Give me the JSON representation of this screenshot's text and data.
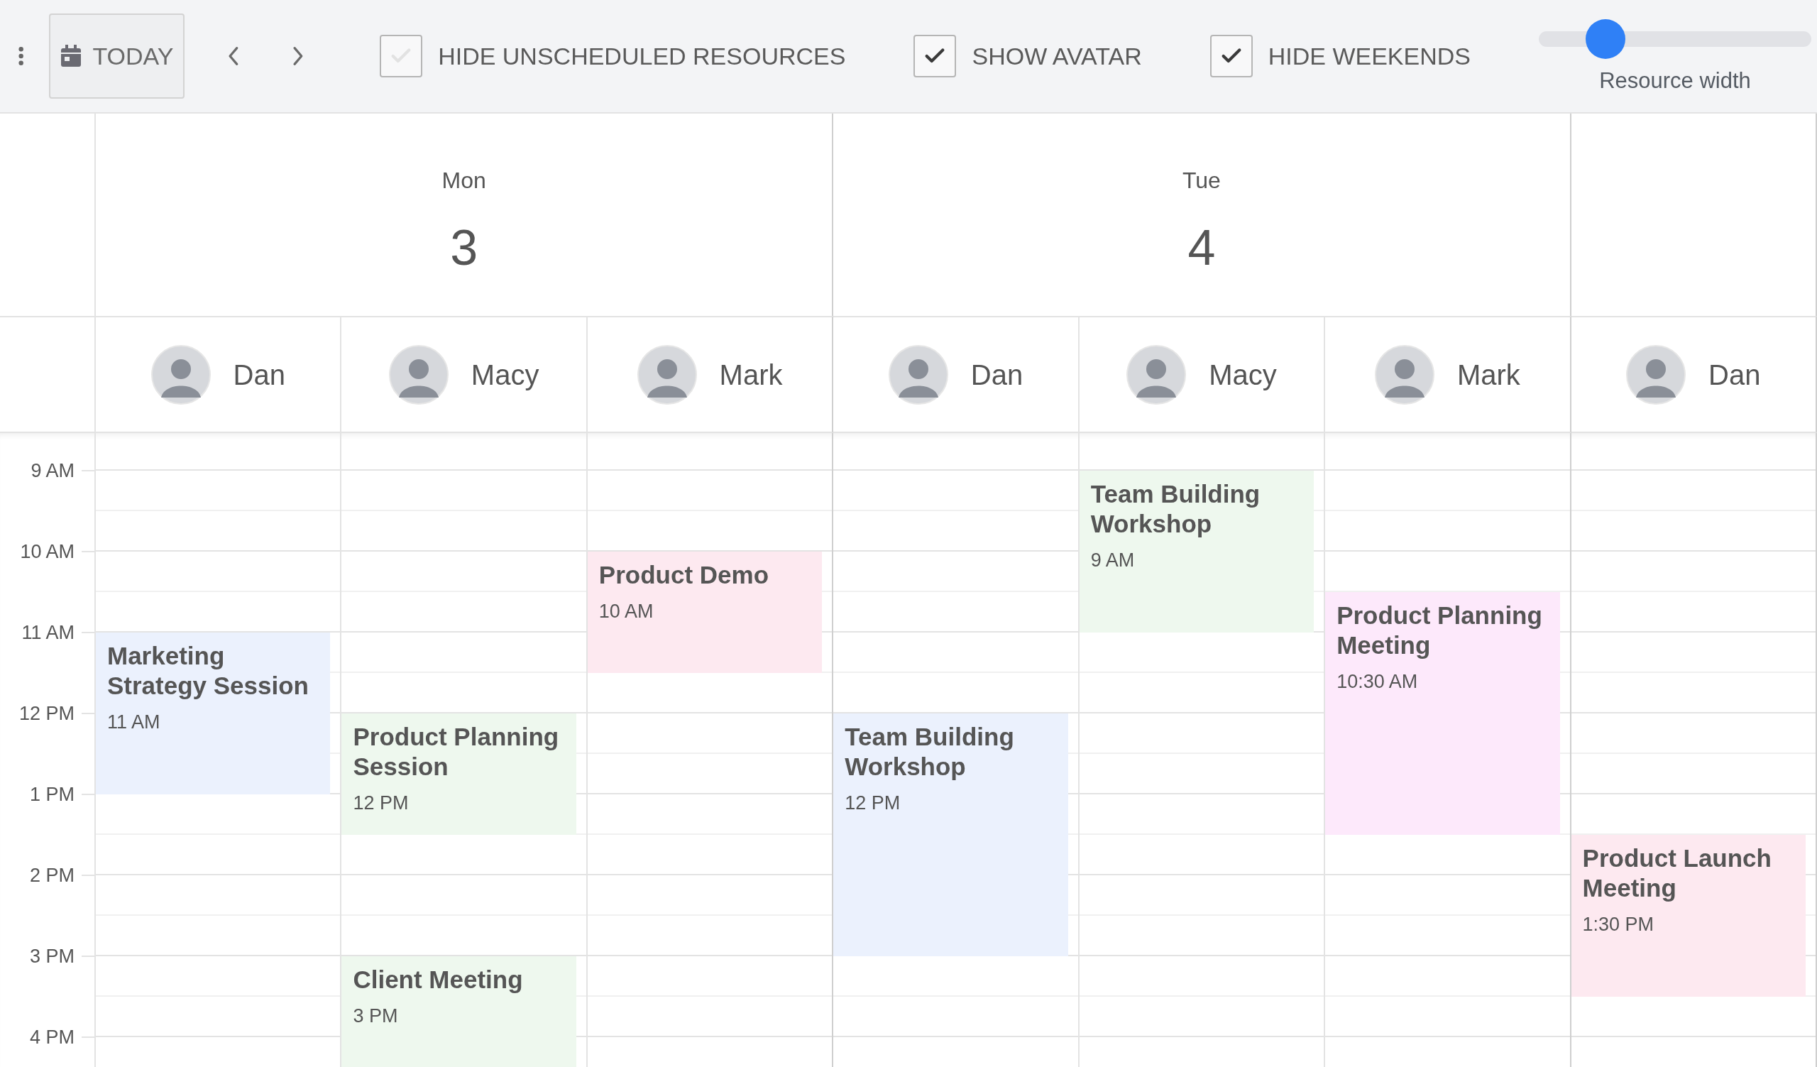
{
  "toolbar": {
    "today_button": "TODAY",
    "options": [
      {
        "label": "HIDE UNSCHEDULED RESOURCES",
        "checked": false
      },
      {
        "label": "SHOW AVATAR",
        "checked": true
      },
      {
        "label": "HIDE WEEKENDS",
        "checked": true
      }
    ],
    "slider": {
      "label": "Resource width",
      "level": 0.2
    }
  },
  "time_labels": [
    "9 AM",
    "10 AM",
    "11 AM",
    "12 PM",
    "1 PM",
    "2 PM",
    "3 PM",
    "4 PM"
  ],
  "days": [
    {
      "weekday": "Mon",
      "date": "3",
      "resources": [
        {
          "name": "Dan",
          "events": [
            {
              "title": "Marketing Strategy Session",
              "time": "11 AM",
              "kind": "medium",
              "color": "#ebf1fd"
            }
          ]
        },
        {
          "name": "Macy",
          "events": [
            {
              "title": "Product Planning Session",
              "time": "12 PM",
              "kind": "short",
              "color": "#eef8ee"
            },
            {
              "title": "Client Meeting",
              "time": "3 PM",
              "kind": "medium",
              "color": "#eef8ee"
            }
          ]
        },
        {
          "name": "Mark",
          "events": [
            {
              "title": "Product Demo",
              "time": "10 AM",
              "kind": "short",
              "color": "#fde9f0"
            }
          ]
        }
      ]
    },
    {
      "weekday": "Tue",
      "date": "4",
      "resources": [
        {
          "name": "Dan",
          "events": [
            {
              "title": "Team Building Workshop",
              "time": "12 PM",
              "kind": "long",
              "color": "#ebf1fd"
            }
          ]
        },
        {
          "name": "Macy",
          "events": [
            {
              "title": "Team Building Workshop",
              "time": "9 AM",
              "kind": "medium",
              "color": "#eef8ee"
            }
          ]
        },
        {
          "name": "Mark",
          "events": [
            {
              "title": "Product Planning Meeting",
              "time": "10:30 AM",
              "kind": "long",
              "color": "#fde9fb"
            }
          ]
        }
      ]
    },
    {
      "resources": [
        {
          "name": "Dan",
          "events": [
            {
              "title": "Product Launch Meeting",
              "time": "1:30 PM",
              "kind": "medium",
              "color": "#fde9f0"
            }
          ]
        }
      ]
    }
  ]
}
